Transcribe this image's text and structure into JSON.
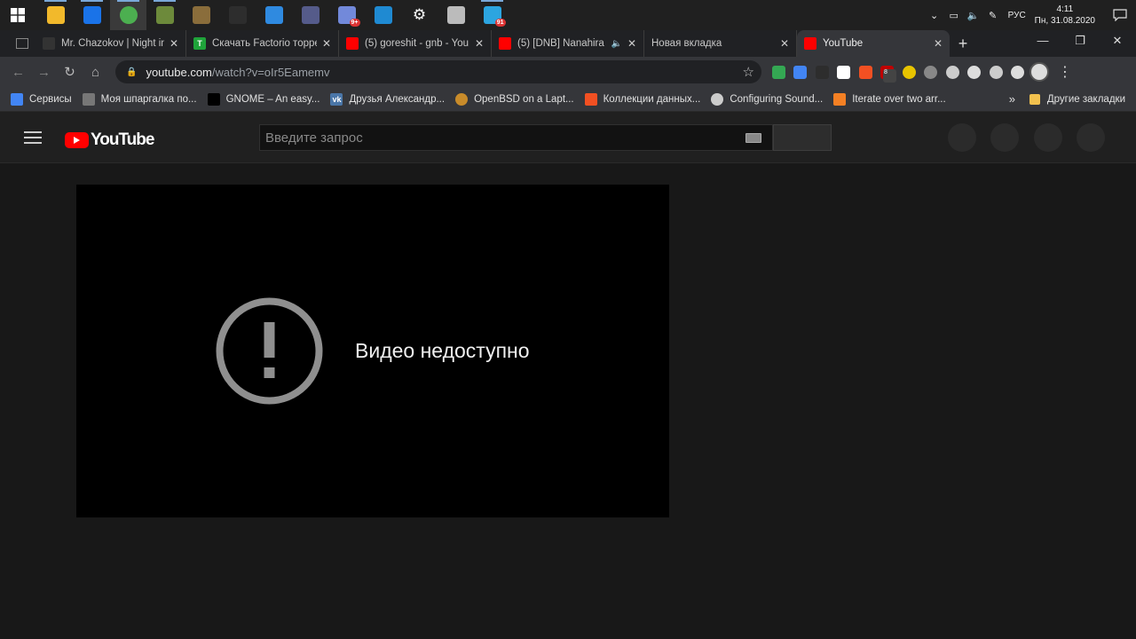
{
  "taskbar": {
    "apps": [
      {
        "icon": "file-explorer-icon",
        "color": "#f2b92b"
      },
      {
        "icon": "mail-icon",
        "color": "#1a73e8"
      },
      {
        "icon": "chrome-icon",
        "color": "#4caf50"
      },
      {
        "icon": "minecraft-icon",
        "color": "#6d8a3b"
      },
      {
        "icon": "minecraft-launcher-icon",
        "color": "#8a6d3b"
      },
      {
        "icon": "terminal-icon",
        "color": "#2d2d2d"
      },
      {
        "icon": "arc-icon",
        "color": "#2f8ae0"
      },
      {
        "icon": "virtualbox-icon",
        "color": "#555b8a"
      },
      {
        "icon": "discord-icon",
        "color": "#7289da",
        "badge": "9+"
      },
      {
        "icon": "vscode-icon",
        "color": "#1f8ad2"
      },
      {
        "icon": "settings-icon",
        "color": "#202020"
      },
      {
        "icon": "tor-icon",
        "color": "#bbbbbb"
      },
      {
        "icon": "telegram-icon",
        "color": "#2ca5e0",
        "badge": "91"
      }
    ],
    "lang": "РУС",
    "time": "4:11",
    "date": "Пн, 31.08.2020"
  },
  "tabs": [
    {
      "title": "Mr. Chazokov | Night in",
      "favicon_color": "#333333",
      "close": "✕"
    },
    {
      "title": "Скачать Factorio торре",
      "favicon_color": "#1fa33a",
      "favicon_text": "T",
      "close": "✕"
    },
    {
      "title": "(5) goreshit - gnb - You",
      "favicon_color": "#ff0000",
      "close": "✕"
    },
    {
      "title": "(5) [DNB] Nanahira",
      "favicon_color": "#ff0000",
      "close": "✕",
      "audio": "🔈"
    },
    {
      "title": "Новая вкладка",
      "favicon_color": "",
      "close": "✕"
    },
    {
      "title": "YouTube",
      "favicon_color": "#ff0000",
      "close": "✕",
      "active": true
    }
  ],
  "window_controls": {
    "minimize": "—",
    "restore": "❐",
    "close": "✕"
  },
  "toolbar": {
    "url_host": "youtube.com",
    "url_path": "/watch?v=oIr5Eamemv",
    "extensions": [
      "#34a853",
      "#4285f4",
      "#2d2d2d",
      "#ffffff",
      "#f25022",
      "#c00000",
      "#e8c400",
      "#888888",
      "#cccccc",
      "#dddddd",
      "#cccccc",
      "#dddddd"
    ],
    "ext_badge": "8"
  },
  "bookmarks": [
    {
      "label": "Сервисы",
      "icon": "apps-grid-icon",
      "color": "#4285f4"
    },
    {
      "label": "Моя шпаргалка по...",
      "icon": "table-icon",
      "color": "#777777"
    },
    {
      "label": "GNOME – An easy...",
      "icon": "gnome-icon",
      "color": "#000000"
    },
    {
      "label": "Друзья Александр...",
      "icon": "vk-icon",
      "color": "#4a76a8"
    },
    {
      "label": "OpenBSD on a Lapt...",
      "icon": "openbsd-icon",
      "color": "#c88b2a"
    },
    {
      "label": "Коллекции данных...",
      "icon": "microsoft-icon",
      "color": "#f25022"
    },
    {
      "label": "Configuring Sound...",
      "icon": "wiki-icon",
      "color": "#cccccc"
    },
    {
      "label": "Iterate over two arr...",
      "icon": "stackoverflow-icon",
      "color": "#f48024"
    }
  ],
  "bookmarks_more": "»",
  "bookmarks_other": "Другие закладки",
  "youtube": {
    "logo_text": "YouTube",
    "search_placeholder": "Введите запрос",
    "error_message": "Видео недоступно"
  }
}
